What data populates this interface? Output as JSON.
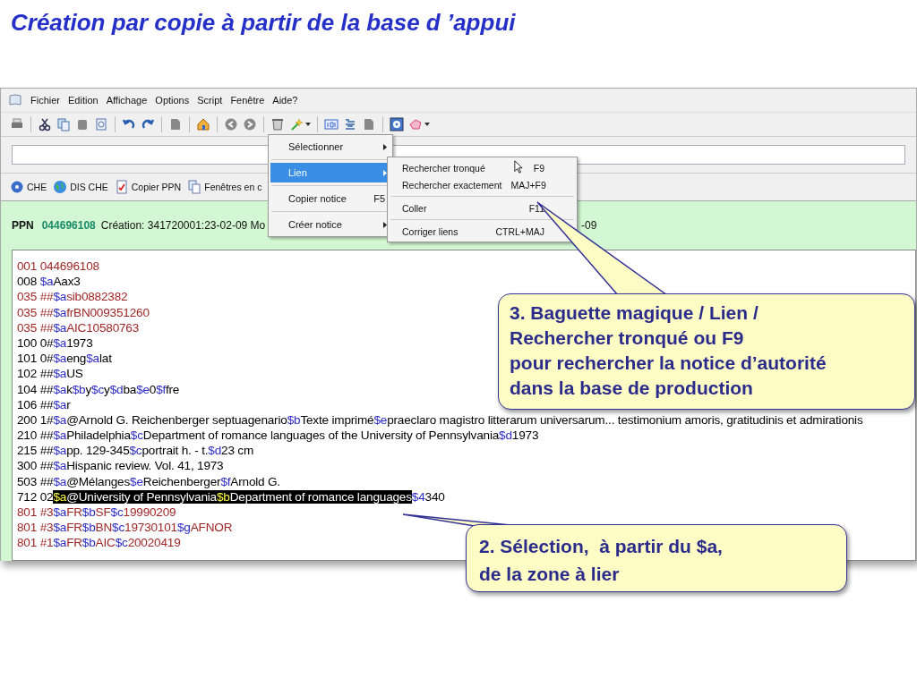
{
  "slide": {
    "title": "Création par copie à partir de la base d ’appui"
  },
  "window": {
    "menu_bar": [
      {
        "label": "Fichier"
      },
      {
        "label": "Edition"
      },
      {
        "label": "Affichage"
      },
      {
        "label": "Options"
      },
      {
        "label": "Script"
      },
      {
        "label": "Fenêtre"
      },
      {
        "label": "Aide?"
      }
    ],
    "link_bar": [
      {
        "label": "CHE",
        "kind": "help"
      },
      {
        "label": "DIS CHE",
        "kind": "globe"
      },
      {
        "label": "Copier PPN",
        "kind": "check"
      },
      {
        "label": "Fenêtres en c",
        "kind": "pages"
      }
    ],
    "status": {
      "label": "PPN",
      "ppn": "044696108",
      "info": "Création: 341720001:23-02-09 Mo",
      "info_tail": "-09"
    },
    "record": [
      {
        "tag": "001 044696108",
        "color": "#a02828"
      },
      {
        "tag": "008 ",
        "color": "#000000",
        "subfields": [
          {
            "code": "$a",
            "value": "Aax3",
            "selected": false
          }
        ]
      },
      {
        "tag": "035 ##",
        "color": "#a02828",
        "subfields": [
          {
            "code": "$a",
            "value": "sib0882382",
            "selected": false
          }
        ]
      },
      {
        "tag": "035 ##",
        "color": "#a02828",
        "subfields": [
          {
            "code": "$a",
            "value": "frBN009351260",
            "selected": false
          }
        ]
      },
      {
        "tag": "035 ##",
        "color": "#a02828",
        "subfields": [
          {
            "code": "$a",
            "value": "AIC10580763",
            "selected": false
          }
        ]
      },
      {
        "tag": "100 0#",
        "color": "#000000",
        "subfields": [
          {
            "code": "$a",
            "value": "1973",
            "selected": false
          }
        ]
      },
      {
        "tag": "101 0#",
        "color": "#000000",
        "subfields": [
          {
            "code": "$a",
            "value": "eng",
            "selected": false
          },
          {
            "code": "$a",
            "value": "lat",
            "selected": false
          }
        ]
      },
      {
        "tag": "102 ##",
        "color": "#000000",
        "subfields": [
          {
            "code": "$a",
            "value": "US",
            "selected": false
          }
        ]
      },
      {
        "tag": "104 ##",
        "color": "#000000",
        "subfields": [
          {
            "code": "$a",
            "value": "k",
            "selected": false
          },
          {
            "code": "$b",
            "value": "y",
            "selected": false
          },
          {
            "code": "$c",
            "value": "y",
            "selected": false
          },
          {
            "code": "$d",
            "value": "ba",
            "selected": false
          },
          {
            "code": "$e",
            "value": "0",
            "selected": false
          },
          {
            "code": "$f",
            "value": "fre",
            "selected": false
          }
        ]
      },
      {
        "tag": "106 ##",
        "color": "#000000",
        "subfields": [
          {
            "code": "$a",
            "value": "r",
            "selected": false
          }
        ]
      },
      {
        "tag": "200 1#",
        "color": "#000000",
        "subfields": [
          {
            "code": "$a",
            "value": "@Arnold G. Reichenberger septuagenario",
            "selected": false
          },
          {
            "code": "$b",
            "value": "Texte imprimé",
            "selected": false
          },
          {
            "code": "$e",
            "value": "praeclaro magistro litterarum universarum... testimonium amoris, gratitudinis et admirationis",
            "selected": false
          }
        ]
      },
      {
        "tag": "210 ##",
        "color": "#000000",
        "subfields": [
          {
            "code": "$a",
            "value": "Philadelphia",
            "selected": false
          },
          {
            "code": "$c",
            "value": "Department of romance languages of the University of Pennsylvania",
            "selected": false
          },
          {
            "code": "$d",
            "value": "1973",
            "selected": false
          }
        ]
      },
      {
        "tag": "215 ##",
        "color": "#000000",
        "subfields": [
          {
            "code": "$a",
            "value": "pp. 129-345",
            "selected": false
          },
          {
            "code": "$c",
            "value": "portrait h. - t.",
            "selected": false
          },
          {
            "code": "$d",
            "value": "23 cm",
            "selected": false
          }
        ]
      },
      {
        "tag": "300 ##",
        "color": "#000000",
        "subfields": [
          {
            "code": "$a",
            "value": "Hispanic review. Vol. 41, 1973",
            "selected": false
          }
        ]
      },
      {
        "tag": "503 ##",
        "color": "#000000",
        "subfields": [
          {
            "code": "$a",
            "value": "@Mélanges",
            "selected": false
          },
          {
            "code": "$e",
            "value": "Reichenberger",
            "selected": false
          },
          {
            "code": "$f",
            "value": "Arnold G.",
            "selected": false
          }
        ]
      },
      {
        "tag": "712 02",
        "color": "#000000",
        "subfields": [
          {
            "code": "$a",
            "value": "@University of Pennsylvania",
            "selected": true
          },
          {
            "code": "$b",
            "value": "Department of romance languages",
            "selected": true
          },
          {
            "code": "$4",
            "value": "340",
            "selected": false
          }
        ]
      },
      {
        "tag": "801 #3",
        "color": "#a02828",
        "subfields": [
          {
            "code": "$a",
            "value": "FR",
            "selected": false
          },
          {
            "code": "$b",
            "value": "SF",
            "selected": false
          },
          {
            "code": "$c",
            "value": "19990209",
            "selected": false
          }
        ]
      },
      {
        "tag": "801 #3",
        "color": "#a02828",
        "subfields": [
          {
            "code": "$a",
            "value": "FR",
            "selected": false
          },
          {
            "code": "$b",
            "value": "BN",
            "selected": false
          },
          {
            "code": "$c",
            "value": "19730101",
            "selected": false
          },
          {
            "code": "$g",
            "value": "AFNOR",
            "selected": false
          }
        ]
      },
      {
        "tag": "801 #1",
        "color": "#a02828",
        "subfields": [
          {
            "code": "$a",
            "value": "FR",
            "selected": false
          },
          {
            "code": "$b",
            "value": "AIC",
            "selected": false
          },
          {
            "code": "$c",
            "value": "20020419",
            "selected": false
          }
        ]
      }
    ],
    "context_menu": [
      {
        "kind": "item",
        "label": "Sélectionner",
        "submenu": true,
        "selected": false
      },
      {
        "kind": "separator"
      },
      {
        "kind": "item",
        "label": "Lien",
        "submenu": true,
        "selected": true
      },
      {
        "kind": "separator"
      },
      {
        "kind": "item",
        "label": "Copier notice",
        "shortcut": "F5",
        "submenu": false,
        "selected": false
      },
      {
        "kind": "separator"
      },
      {
        "kind": "item",
        "label": "Créer notice",
        "submenu": true,
        "selected": false
      }
    ],
    "submenu": [
      {
        "kind": "item",
        "label": "Rechercher tronqué",
        "shortcut": "F9"
      },
      {
        "kind": "item",
        "label": "Rechercher exactement",
        "shortcut": "MAJ+F9"
      },
      {
        "kind": "separator"
      },
      {
        "kind": "item",
        "label": "Coller",
        "shortcut": "F11"
      },
      {
        "kind": "separator"
      },
      {
        "kind": "item",
        "label": "Corriger liens",
        "shortcut": "CTRL+MAJ"
      }
    ]
  },
  "callouts": [
    {
      "lines": [
        "3. Baguette magique / Lien /",
        "Rechercher tronqué ou F9",
        "pour rechercher la notice d’autorité",
        "dans la base de production"
      ]
    },
    {
      "lines": [
        "2. Sélection,  à partir du $a,",
        "de la zone à lier"
      ]
    }
  ]
}
